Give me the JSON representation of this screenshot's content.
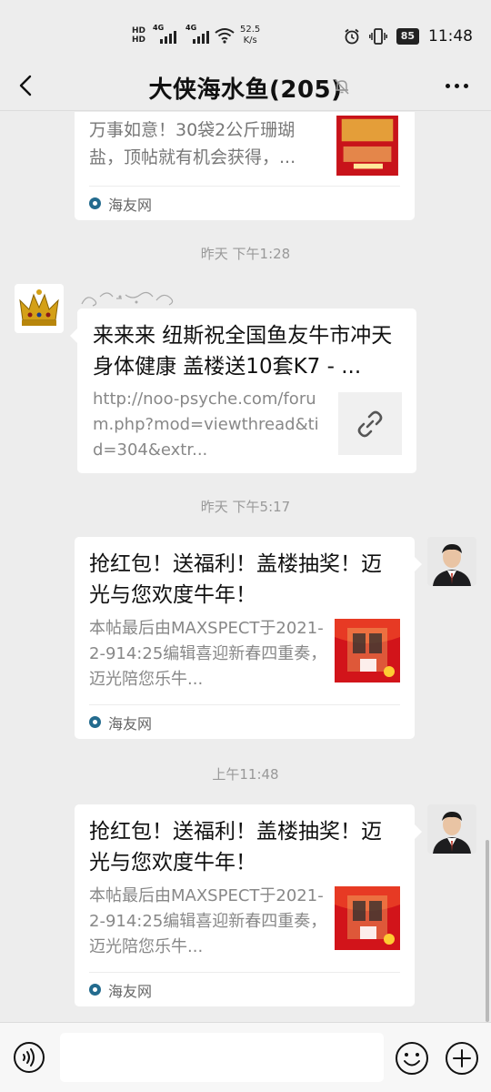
{
  "status_bar": {
    "hd1": "HD",
    "hd2": "HD",
    "net1": "4G",
    "net2": "4G",
    "speed_value": "52.5",
    "speed_unit": "K/s",
    "battery": "85",
    "time": "11:48"
  },
  "header": {
    "title": "大侠海水鱼(205)"
  },
  "messages": [
    {
      "title_partial": "",
      "desc": "万事如意！30袋2公斤珊瑚盐，顶帖就有机会获得，...",
      "source": "海友网"
    },
    {
      "time": "昨天 下午1:28",
      "title": "来来来 纽斯祝全国鱼友牛市冲天 身体健康 盖楼送10套K7 - ...",
      "url": "http://noo-psyche.com/forum.php?mod=viewthread&tid=304&extr..."
    },
    {
      "time": "昨天 下午5:17",
      "title": "抢红包！送福利！盖楼抽奖！迈光与您欢度牛年！",
      "desc": "本帖最后由MAXSPECT于2021-2-914:25编辑喜迎新春四重奏，迈光陪您乐牛...",
      "source": "海友网"
    },
    {
      "time": "上午11:48",
      "title": "抢红包！送福利！盖楼抽奖！迈光与您欢度牛年！",
      "desc": "本帖最后由MAXSPECT于2021-2-914:25编辑喜迎新春四重奏，迈光陪您乐牛...",
      "source": "海友网"
    }
  ],
  "input": {
    "placeholder": ""
  },
  "colors": {
    "background": "#ededed",
    "bubble": "#ffffff",
    "muted_text": "#888888",
    "source_icon": "#236b8e"
  },
  "icons": {
    "back": "chevron-left-icon",
    "mute": "bell-off-icon",
    "more": "more-icon",
    "voice": "voice-icon",
    "emoji": "emoji-icon",
    "plus": "plus-icon",
    "link": "link-icon"
  }
}
